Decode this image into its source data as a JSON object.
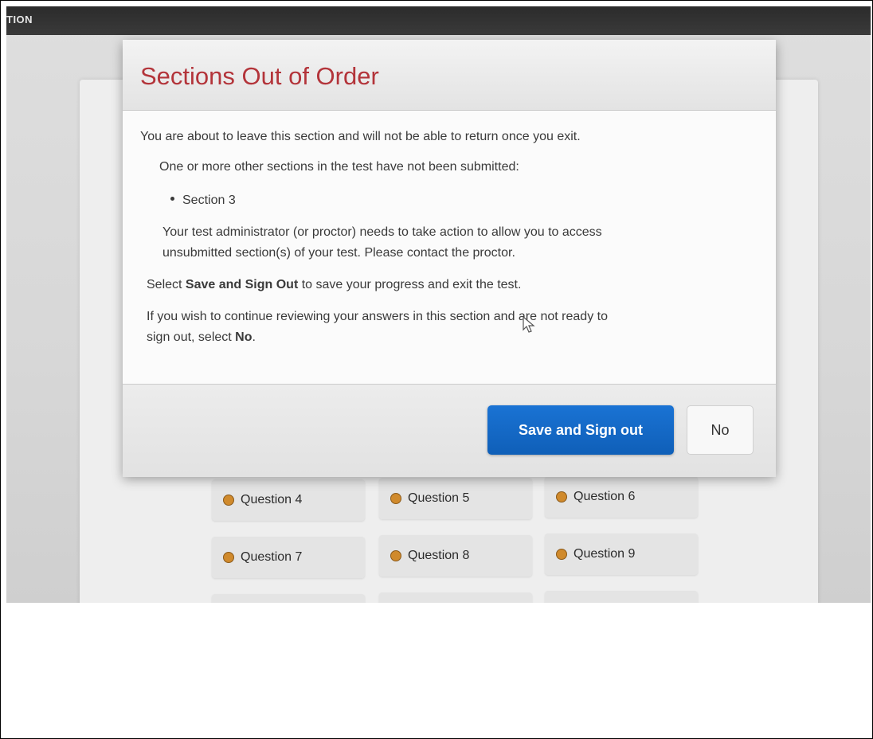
{
  "topbar": {
    "label": "TION"
  },
  "dialog": {
    "title": "Sections Out of Order",
    "intro": "You are about to leave this section and will not be able to return once you exit.",
    "unsubmitted_note": "One or more other sections in the test have not been submitted:",
    "unsubmitted_sections": [
      "Section 3"
    ],
    "proctor_note_line1": "Your test administrator (or proctor) needs to take action to allow you to access",
    "proctor_note_line2": "unsubmitted section(s) of your test. Please contact the proctor.",
    "save_instruction": {
      "prefix": "Select ",
      "bold": "Save and Sign Out",
      "suffix": " to save your progress and exit the test."
    },
    "continue_instruction": {
      "line1": "If you wish to continue reviewing your answers in this section and are not ready to",
      "prefix": "sign out, select ",
      "bold": "No",
      "suffix": "."
    },
    "buttons": {
      "primary": "Save and Sign out",
      "secondary": "No"
    }
  },
  "questions": [
    {
      "label": "Question 4",
      "status_color": "#d08a2c"
    },
    {
      "label": "Question 5",
      "status_color": "#d08a2c"
    },
    {
      "label": "Question 6",
      "status_color": "#d08a2c"
    },
    {
      "label": "Question 7",
      "status_color": "#d08a2c"
    },
    {
      "label": "Question 8",
      "status_color": "#d08a2c"
    },
    {
      "label": "Question 9",
      "status_color": "#d08a2c"
    }
  ]
}
